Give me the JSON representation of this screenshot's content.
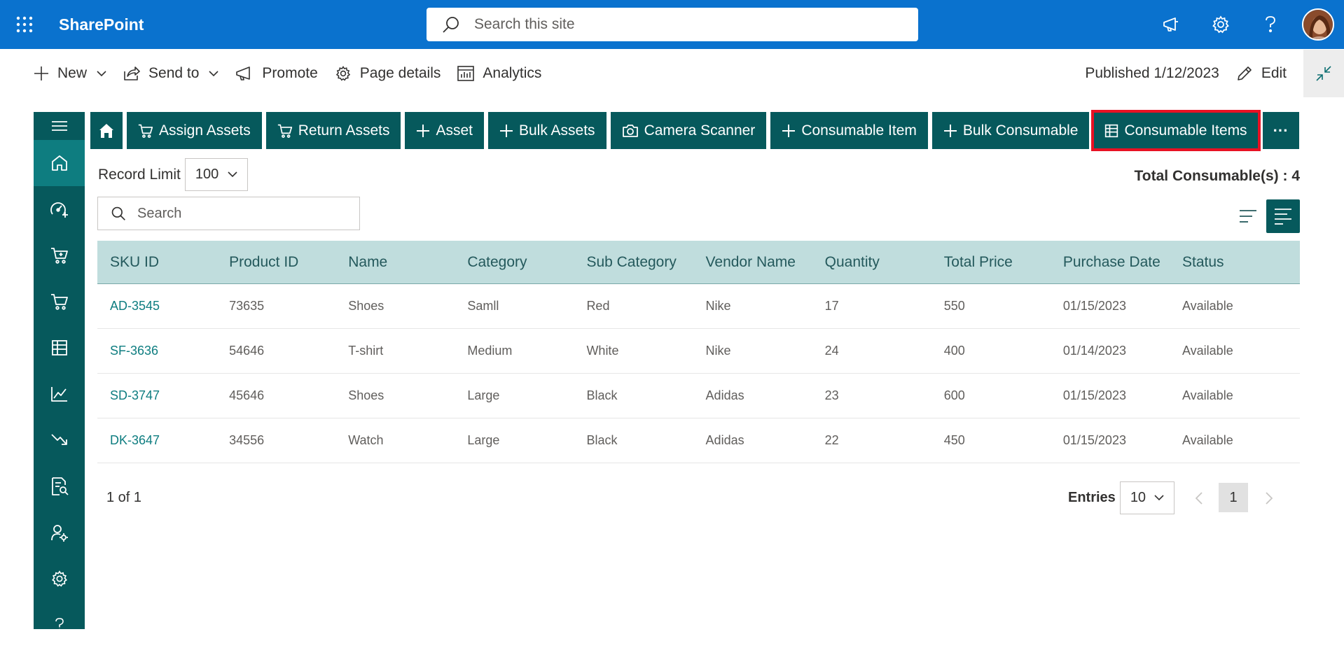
{
  "suite_bar": {
    "brand": "SharePoint",
    "search_placeholder": "Search this site",
    "color": "#0a72ce"
  },
  "command_bar": {
    "new_label": "New",
    "send_to_label": "Send to",
    "promote_label": "Promote",
    "page_details_label": "Page details",
    "analytics_label": "Analytics",
    "published_text": "Published 1/12/2023",
    "edit_label": "Edit"
  },
  "sidebar": {
    "icons": [
      "menu-icon",
      "home-icon",
      "dashboard-add-icon",
      "cart-icon",
      "cart-return-icon",
      "grid-list-icon",
      "line-chart-icon",
      "trend-down-icon",
      "report-search-icon",
      "user-settings-icon",
      "gear-icon",
      "help-icon"
    ],
    "color": "#06595c",
    "active_color": "#0e7d80"
  },
  "app_toolbar": {
    "buttons": [
      {
        "label": "Assign Assets",
        "icon": "cart-icon"
      },
      {
        "label": "Return Assets",
        "icon": "cart-icon"
      },
      {
        "label": "Asset",
        "icon": "plus-icon"
      },
      {
        "label": "Bulk Assets",
        "icon": "plus-icon"
      },
      {
        "label": "Camera Scanner",
        "icon": "camera-icon"
      },
      {
        "label": "Consumable Item",
        "icon": "plus-icon"
      },
      {
        "label": "Bulk Consumable",
        "icon": "plus-icon"
      },
      {
        "label": "Consumable Items",
        "icon": "grid-list-icon",
        "selected": true
      }
    ],
    "more_label": "···",
    "highlight_color": "#e81123"
  },
  "filters": {
    "record_limit_label": "Record Limit",
    "record_limit_value": "100",
    "total_text": "Total Consumable(s) : 4",
    "search_placeholder": "Search"
  },
  "table": {
    "columns": [
      "SKU ID",
      "Product ID",
      "Name",
      "Category",
      "Sub Category",
      "Vendor Name",
      "Quantity",
      "Total Price",
      "Purchase Date",
      "Status"
    ],
    "rows": [
      [
        "AD-3545",
        "73635",
        "Shoes",
        "Samll",
        "Red",
        "Nike",
        "17",
        "550",
        "01/15/2023",
        "Available"
      ],
      [
        "SF-3636",
        "54646",
        "T-shirt",
        "Medium",
        "White",
        "Nike",
        "24",
        "400",
        "01/14/2023",
        "Available"
      ],
      [
        "SD-3747",
        "45646",
        "Shoes",
        "Large",
        "Black",
        "Adidas",
        "23",
        "600",
        "01/15/2023",
        "Available"
      ],
      [
        "DK-3647",
        "34556",
        "Watch",
        "Large",
        "Black",
        "Adidas",
        "22",
        "450",
        "01/15/2023",
        "Available"
      ]
    ],
    "header_color": "#c0dddd"
  },
  "pagination": {
    "page_info": "1 of 1",
    "entries_label": "Entries",
    "entries_value": "10",
    "current_page": "1"
  }
}
